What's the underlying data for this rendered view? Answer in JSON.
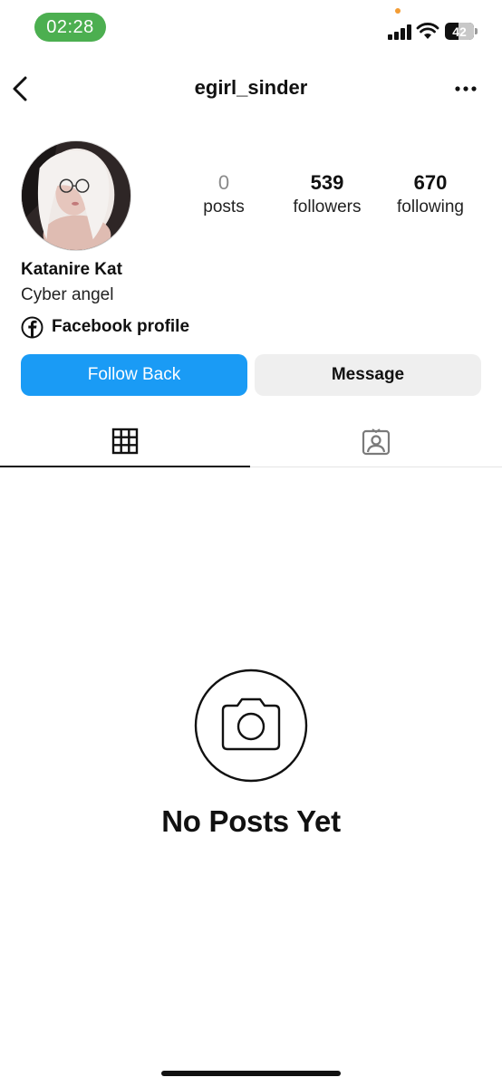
{
  "status_bar": {
    "time": "02:28",
    "battery_level": "42",
    "time_pill_color": "#4caf50",
    "privacy_dot_color": "#f39c34"
  },
  "header": {
    "username": "egirl_sinder",
    "back_icon": "chevron-left-icon",
    "more_icon": "more-horizontal-icon"
  },
  "profile": {
    "avatar_icon": "avatar-photo",
    "display_name": "Katanire Kat",
    "bio": "Cyber angel",
    "facebook_link": "Facebook profile",
    "facebook_icon": "facebook-icon"
  },
  "stats": [
    {
      "value": "0",
      "label": "posts"
    },
    {
      "value": "539",
      "label": "followers"
    },
    {
      "value": "670",
      "label": "following"
    }
  ],
  "actions": {
    "follow_back": "Follow Back",
    "message": "Message",
    "follow_color": "#1a9bf5",
    "message_color": "#efefef"
  },
  "tabs": [
    {
      "icon": "grid-icon",
      "active": true
    },
    {
      "icon": "tagged-person-icon",
      "active": false
    }
  ],
  "empty_state": {
    "icon": "camera-icon",
    "title": "No Posts Yet"
  }
}
